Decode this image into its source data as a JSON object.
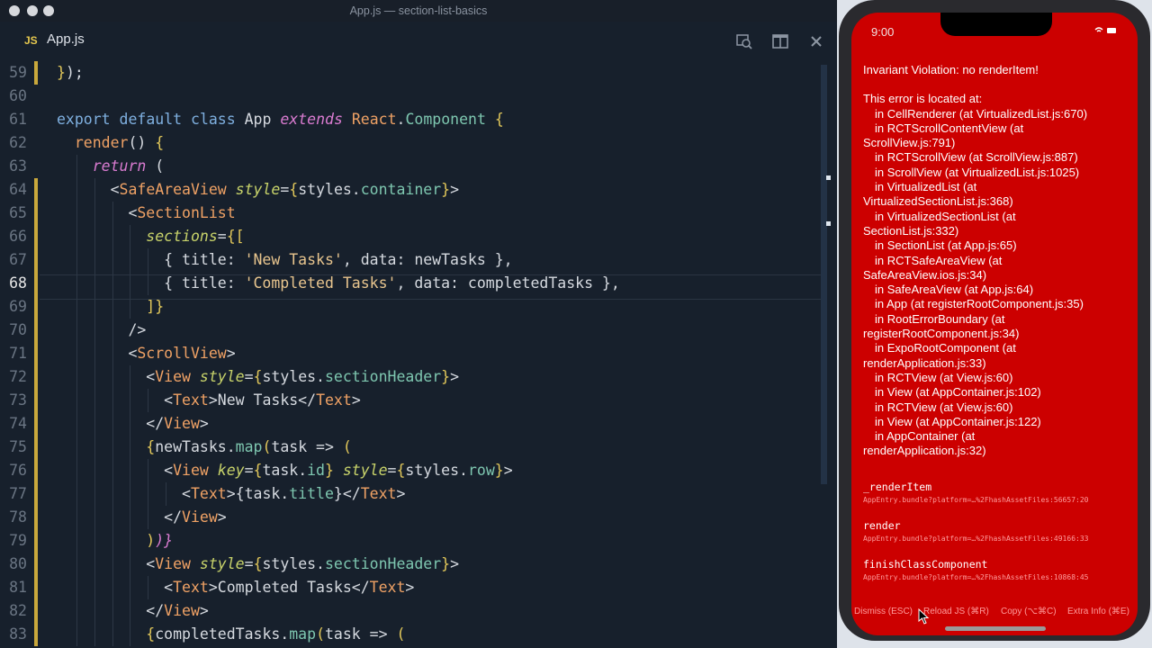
{
  "window": {
    "title": "App.js — section-list-basics"
  },
  "tab": {
    "lang": "JS",
    "name": "App.js"
  },
  "toolbar_icons": [
    "search-in-files-icon",
    "split-editor-icon",
    "close-icon"
  ],
  "editor": {
    "active_line": "68",
    "lines": [
      {
        "no": "59",
        "mark": true,
        "indent": 0,
        "tokens": [
          [
            "br",
            "}"
          ],
          [
            "pl",
            ");"
          ]
        ]
      },
      {
        "no": "60",
        "mark": false,
        "indent": 0,
        "tokens": []
      },
      {
        "no": "61",
        "mark": false,
        "indent": 0,
        "tokens": [
          [
            "kw",
            "export default class "
          ],
          [
            "pl",
            "App "
          ],
          [
            "it",
            "extends "
          ],
          [
            "tag",
            "React"
          ],
          [
            "pl",
            "."
          ],
          [
            "prop",
            "Component "
          ],
          [
            "br",
            "{"
          ]
        ]
      },
      {
        "no": "62",
        "mark": false,
        "indent": 1,
        "tokens": [
          [
            "tag",
            "render"
          ],
          [
            "pl",
            "() "
          ],
          [
            "br",
            "{"
          ]
        ]
      },
      {
        "no": "63",
        "mark": false,
        "indent": 2,
        "tokens": [
          [
            "it",
            "return "
          ],
          [
            "pl",
            "("
          ]
        ]
      },
      {
        "no": "64",
        "mark": true,
        "indent": 3,
        "tokens": [
          [
            "pl",
            "<"
          ],
          [
            "tag",
            "SafeAreaView "
          ],
          [
            "attr",
            "style"
          ],
          [
            "pl",
            "="
          ],
          [
            "br",
            "{"
          ],
          [
            "pl",
            "styles."
          ],
          [
            "prop",
            "container"
          ],
          [
            "br",
            "}"
          ],
          [
            "pl",
            ">"
          ]
        ]
      },
      {
        "no": "65",
        "mark": true,
        "indent": 4,
        "tokens": [
          [
            "pl",
            "<"
          ],
          [
            "tag",
            "SectionList"
          ]
        ]
      },
      {
        "no": "66",
        "mark": true,
        "indent": 5,
        "tokens": [
          [
            "attr",
            "sections"
          ],
          [
            "pl",
            "="
          ],
          [
            "br",
            "{["
          ]
        ]
      },
      {
        "no": "67",
        "mark": true,
        "indent": 6,
        "tokens": [
          [
            "pl",
            "{ title: "
          ],
          [
            "str",
            "'New Tasks'"
          ],
          [
            "pl",
            ", data: newTasks },"
          ]
        ]
      },
      {
        "no": "68",
        "mark": true,
        "indent": 6,
        "tokens": [
          [
            "pl",
            "{ title: "
          ],
          [
            "str",
            "'Completed Tasks'"
          ],
          [
            "pl",
            ", data: completedTasks },"
          ]
        ]
      },
      {
        "no": "69",
        "mark": true,
        "indent": 5,
        "tokens": [
          [
            "br",
            "]}"
          ]
        ]
      },
      {
        "no": "70",
        "mark": true,
        "indent": 4,
        "tokens": [
          [
            "pl",
            "/>"
          ]
        ]
      },
      {
        "no": "71",
        "mark": true,
        "indent": 4,
        "tokens": [
          [
            "pl",
            "<"
          ],
          [
            "tag",
            "ScrollView"
          ],
          [
            "pl",
            ">"
          ]
        ]
      },
      {
        "no": "72",
        "mark": true,
        "indent": 5,
        "tokens": [
          [
            "pl",
            "<"
          ],
          [
            "tag",
            "View "
          ],
          [
            "attr",
            "style"
          ],
          [
            "pl",
            "="
          ],
          [
            "br",
            "{"
          ],
          [
            "pl",
            "styles."
          ],
          [
            "prop",
            "sectionHeader"
          ],
          [
            "br",
            "}"
          ],
          [
            "pl",
            ">"
          ]
        ]
      },
      {
        "no": "73",
        "mark": true,
        "indent": 6,
        "tokens": [
          [
            "pl",
            "<"
          ],
          [
            "tag",
            "Text"
          ],
          [
            "pl",
            ">New Tasks</"
          ],
          [
            "tag",
            "Text"
          ],
          [
            "pl",
            ">"
          ]
        ]
      },
      {
        "no": "74",
        "mark": true,
        "indent": 5,
        "tokens": [
          [
            "pl",
            "</"
          ],
          [
            "tag",
            "View"
          ],
          [
            "pl",
            ">"
          ]
        ]
      },
      {
        "no": "75",
        "mark": true,
        "indent": 5,
        "tokens": [
          [
            "br",
            "{"
          ],
          [
            "pl",
            "newTasks."
          ],
          [
            "prop",
            "map"
          ],
          [
            "br",
            "("
          ],
          [
            "pl",
            "task => "
          ],
          [
            "br",
            "("
          ]
        ]
      },
      {
        "no": "76",
        "mark": true,
        "indent": 6,
        "tokens": [
          [
            "pl",
            "<"
          ],
          [
            "tag",
            "View "
          ],
          [
            "attr",
            "key"
          ],
          [
            "pl",
            "="
          ],
          [
            "br",
            "{"
          ],
          [
            "pl",
            "task."
          ],
          [
            "prop",
            "id"
          ],
          [
            "br",
            "} "
          ],
          [
            "attr",
            "style"
          ],
          [
            "pl",
            "="
          ],
          [
            "br",
            "{"
          ],
          [
            "pl",
            "styles."
          ],
          [
            "prop",
            "row"
          ],
          [
            "br",
            "}"
          ],
          [
            "pl",
            ">"
          ]
        ]
      },
      {
        "no": "77",
        "mark": true,
        "indent": 7,
        "tokens": [
          [
            "pl",
            "<"
          ],
          [
            "tag",
            "Text"
          ],
          [
            "pl",
            ">{task."
          ],
          [
            "prop",
            "title"
          ],
          [
            "pl",
            "}</"
          ],
          [
            "tag",
            "Text"
          ],
          [
            "pl",
            ">"
          ]
        ]
      },
      {
        "no": "78",
        "mark": true,
        "indent": 6,
        "tokens": [
          [
            "pl",
            "</"
          ],
          [
            "tag",
            "View"
          ],
          [
            "pl",
            ">"
          ]
        ]
      },
      {
        "no": "79",
        "mark": true,
        "indent": 5,
        "tokens": [
          [
            "br",
            ")"
          ],
          [
            "it",
            ")}"
          ]
        ]
      },
      {
        "no": "80",
        "mark": true,
        "indent": 5,
        "tokens": [
          [
            "pl",
            "<"
          ],
          [
            "tag",
            "View "
          ],
          [
            "attr",
            "style"
          ],
          [
            "pl",
            "="
          ],
          [
            "br",
            "{"
          ],
          [
            "pl",
            "styles."
          ],
          [
            "prop",
            "sectionHeader"
          ],
          [
            "br",
            "}"
          ],
          [
            "pl",
            ">"
          ]
        ]
      },
      {
        "no": "81",
        "mark": true,
        "indent": 6,
        "tokens": [
          [
            "pl",
            "<"
          ],
          [
            "tag",
            "Text"
          ],
          [
            "pl",
            ">Completed Tasks</"
          ],
          [
            "tag",
            "Text"
          ],
          [
            "pl",
            ">"
          ]
        ]
      },
      {
        "no": "82",
        "mark": true,
        "indent": 5,
        "tokens": [
          [
            "pl",
            "</"
          ],
          [
            "tag",
            "View"
          ],
          [
            "pl",
            ">"
          ]
        ]
      },
      {
        "no": "83",
        "mark": true,
        "indent": 5,
        "tokens": [
          [
            "br",
            "{"
          ],
          [
            "pl",
            "completedTasks."
          ],
          [
            "prop",
            "map"
          ],
          [
            "br",
            "("
          ],
          [
            "pl",
            "task => "
          ],
          [
            "br",
            "("
          ]
        ]
      }
    ]
  },
  "simulator": {
    "time": "9:00",
    "error_title": "Invariant Violation: no renderItem!",
    "located": "This error is located at:",
    "stack": [
      {
        "t": "in CellRenderer (at VirtualizedList.js:670)",
        "indent": true
      },
      {
        "t": "in RCTScrollContentView (at",
        "indent": true
      },
      {
        "t": "ScrollView.js:791)",
        "indent": false
      },
      {
        "t": "in RCTScrollView (at ScrollView.js:887)",
        "indent": true
      },
      {
        "t": "in ScrollView (at VirtualizedList.js:1025)",
        "indent": true
      },
      {
        "t": "in VirtualizedList (at",
        "indent": true
      },
      {
        "t": "VirtualizedSectionList.js:368)",
        "indent": false
      },
      {
        "t": "in VirtualizedSectionList (at",
        "indent": true
      },
      {
        "t": "SectionList.js:332)",
        "indent": false
      },
      {
        "t": "in SectionList (at App.js:65)",
        "indent": true
      },
      {
        "t": "in RCTSafeAreaView (at",
        "indent": true
      },
      {
        "t": "SafeAreaView.ios.js:34)",
        "indent": false
      },
      {
        "t": "in SafeAreaView (at App.js:64)",
        "indent": true
      },
      {
        "t": "in App (at registerRootComponent.js:35)",
        "indent": true
      },
      {
        "t": "in RootErrorBoundary (at",
        "indent": true
      },
      {
        "t": "registerRootComponent.js:34)",
        "indent": false
      },
      {
        "t": "in ExpoRootComponent (at",
        "indent": true
      },
      {
        "t": "renderApplication.js:33)",
        "indent": false
      },
      {
        "t": "in RCTView (at View.js:60)",
        "indent": true
      },
      {
        "t": "in View (at AppContainer.js:102)",
        "indent": true
      },
      {
        "t": "in RCTView (at View.js:60)",
        "indent": true
      },
      {
        "t": "in View (at AppContainer.js:122)",
        "indent": true
      },
      {
        "t": "in AppContainer (at",
        "indent": true
      },
      {
        "t": "renderApplication.js:32)",
        "indent": false
      }
    ],
    "frames": [
      {
        "fn": "_renderItem",
        "loc": "AppEntry.bundle?platform=…%2FhashAssetFiles:56657:20"
      },
      {
        "fn": "render",
        "loc": "AppEntry.bundle?platform=…%2FhashAssetFiles:49166:33"
      },
      {
        "fn": "finishClassComponent",
        "loc": "AppEntry.bundle?platform=…%2FhashAssetFiles:10868:45"
      }
    ],
    "actions": {
      "dismiss": "Dismiss (ESC)",
      "reload": "Reload JS (⌘R)",
      "copy": "Copy (⌥⌘C)",
      "extra": "Extra Info (⌘E)"
    }
  }
}
